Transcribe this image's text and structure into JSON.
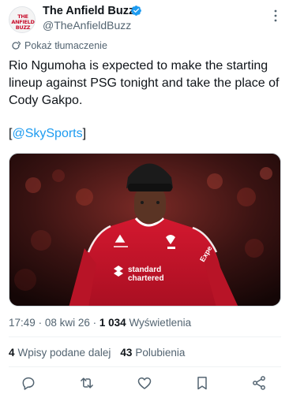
{
  "author": {
    "name": "The Anfield Buzz",
    "handle": "@TheAnfieldBuzz",
    "avatar_text": "THE ANFIELD BUZZ",
    "verified": true
  },
  "translate_label": "Pokaż tłumaczenie",
  "tweet": {
    "text": "Rio Ngumoha is expected to make the starting lineup against PSG tonight and take the place of Cody Gakpo.",
    "mention_open": "[",
    "mention": "@SkySports",
    "mention_close": "]"
  },
  "media": {
    "description": "player-photo",
    "shirt_sponsor": "Standard Chartered",
    "shirt_right": "Expedia"
  },
  "meta": {
    "time": "17:49",
    "date": "08 kwi 26",
    "views": "1 034",
    "views_label": "Wyświetlenia"
  },
  "stats": {
    "reposts_count": "4",
    "reposts_label": "Wpisy podane dalej",
    "likes_count": "43",
    "likes_label": "Polubienia"
  },
  "icons": {
    "verified": "verified-badge-icon",
    "more": "more-vertical-icon",
    "translate": "translate-icon",
    "reply": "reply-icon",
    "repost": "repost-icon",
    "like": "like-icon",
    "bookmark": "bookmark-icon",
    "share": "share-icon"
  },
  "colors": {
    "accent": "#1d9bf0",
    "text": "#0f1419",
    "secondary": "#536471",
    "kit_red": "#c8102e"
  }
}
